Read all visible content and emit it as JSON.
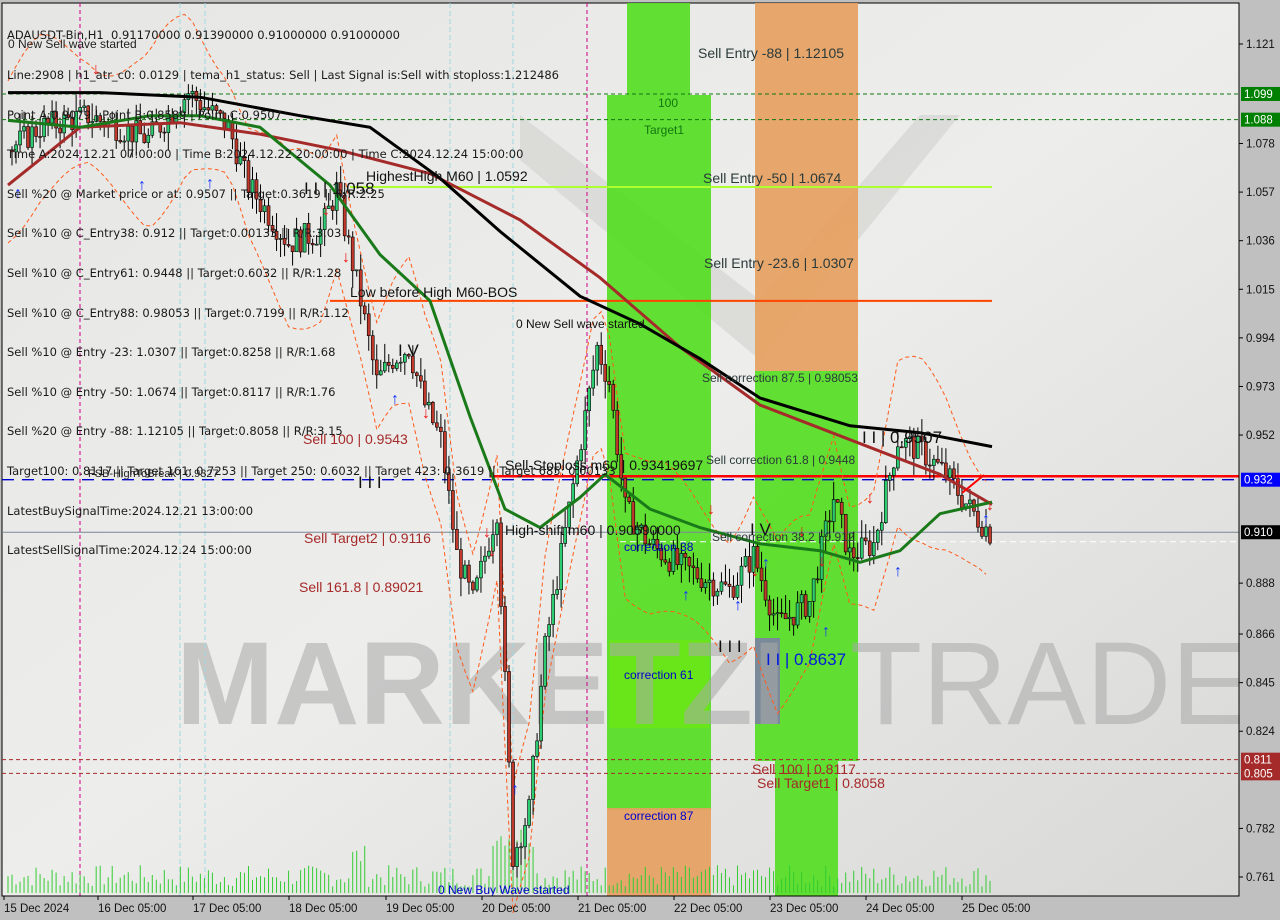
{
  "header": {
    "symbol_line": "ADAUSDT-Bin,H1  0.91170000 0.91390000 0.91000000 0.91000000",
    "info_lines": [
      "Line:2908 | h1_atr_c0: 0.0129 | tema_h1_status: Sell | Last Signal is:Sell with stoploss:1.212486",
      "Point A:0.9079 | Point B:0.8589 | Point C:0.9507",
      "Time A:2024.12.21 07:00:00 | Time B:2024.12.22 20:00:00 | Time C:2024.12.24 15:00:00",
      "Sell %20 @ Market price or at: 0.9507 || Target:0.3619 || R/R:2.25",
      "Sell %10 @ C_Entry38: 0.912 || Target:0.00133 || R/R:3.03",
      "Sell %10 @ C_Entry61: 0.9448 || Target:0.6032 || R/R:1.28",
      "Sell %10 @ C_Entry88: 0.98053 || Target:0.7199 || R/R:1.12",
      "Sell %10 @ Entry -23: 1.0307 || Target:0.8258 || R/R:1.68",
      "Sell %10 @ Entry -50: 1.0674 || Target:0.8117 || R/R:1.76",
      "Sell %20 @ Entry -88: 1.12105 || Target:0.8058 || R/R:3.15",
      "Target100: 0.8117 || Target 161: 0.7253 || Target 250: 0.6032 || Target 423: 0.3619 || Target 685: 0.00133",
      "LatestBuySignalTime:2024.12.21 13:00:00",
      "LatestSellSignalTime:2024.12.24 15:00:00"
    ],
    "overlap_label": "0 New Sell wave started"
  },
  "watermark": {
    "left": "MARKETZI",
    "right": "TRADE"
  },
  "colors": {
    "background": "#c0c0c0",
    "plot_bg": "#e2e2e0",
    "bull": "#2ecc71",
    "bear": "#c0392b",
    "zone_green": "#55dd22",
    "zone_orange": "#e6a060",
    "ma_black": "#000000",
    "ma_brown": "#a52a2a",
    "ma_green": "#1a7a1a",
    "stoploss_red": "#ff0000",
    "fsb_blue": "#0000cc",
    "entry_lime": "#adff2f",
    "bos_orange": "#ff4500"
  },
  "chart_data": {
    "type": "candlestick",
    "title": "ADAUSDT-Bin,H1",
    "ohlc_current": {
      "open": 0.9117,
      "high": 0.9139,
      "low": 0.91,
      "close": 0.91
    },
    "ylim": [
      0.755,
      1.135
    ],
    "y_ticks": [
      "1.121",
      "1.078",
      "1.057",
      "1.036",
      "1.015",
      "0.994",
      "0.973",
      "0.952",
      "0.888",
      "0.866",
      "0.845",
      "0.824",
      "0.782",
      "0.761"
    ],
    "x_ticks": [
      "15 Dec 2024",
      "16 Dec 05:00",
      "17 Dec 05:00",
      "18 Dec 05:00",
      "19 Dec 05:00",
      "20 Dec 05:00",
      "21 Dec 05:00",
      "22 Dec 05:00",
      "23 Dec 05:00",
      "24 Dec 05:00",
      "25 Dec 05:00"
    ],
    "price_tags": [
      {
        "value": "1.099",
        "price": 1.0994,
        "color": "#008000"
      },
      {
        "value": "1.088",
        "price": 1.0883,
        "color": "#008000"
      },
      {
        "value": "0.932",
        "price": 0.9327,
        "color": "#0000ff"
      },
      {
        "value": "0.910",
        "price": 0.91,
        "color": "#000000"
      },
      {
        "value": "0.811",
        "price": 0.8117,
        "color": "#a52a2a"
      },
      {
        "value": "0.805",
        "price": 0.8058,
        "color": "#a52a2a"
      }
    ],
    "levels": [
      {
        "name": "highest-high",
        "label": "HighestHigh   M60 | 1.0592",
        "price": 1.0592
      },
      {
        "name": "low-before-high",
        "label": "Low before High   M60-BOS",
        "price": 1.01
      },
      {
        "name": "fsb-high-to-break",
        "label": "FSB-HighToBreak | 0.9327",
        "price": 0.9327
      },
      {
        "name": "sell-stoploss",
        "label": "Sell-Stoploss m60 | 0.93419697",
        "price": 0.9342
      },
      {
        "name": "high-shift",
        "label": "High-shift m60 | 0.90590000",
        "price": 0.9059
      },
      {
        "name": "current-price",
        "label": "",
        "price": 0.91
      },
      {
        "name": "target-100",
        "label": "",
        "price": 1.0994
      },
      {
        "name": "target-1",
        "label": "",
        "price": 1.0883
      },
      {
        "name": "sell-100-low",
        "label": "Sell 100 | 0.8117",
        "price": 0.8117
      },
      {
        "name": "sell-target1",
        "label": "Sell Target1 | 0.8058",
        "price": 0.8058
      }
    ],
    "annotations": [
      {
        "text": "Sell Entry -88 | 1.12105",
        "price": 1.12105
      },
      {
        "text": "Sell Entry -50 | 1.0674",
        "price": 1.0674
      },
      {
        "text": "Sell Entry -23.6 | 1.0307",
        "price": 1.0307
      },
      {
        "text": "Sell correction 87.5 | 0.98053",
        "price": 0.98053
      },
      {
        "text": "Sell correction 61.8 | 0.9448",
        "price": 0.9448
      },
      {
        "text": "Sell correction 38.2 | 0.912",
        "price": 0.912
      },
      {
        "text": "Sell 100 | 0.9543",
        "price": 0.9543
      },
      {
        "text": "Sell Target2 | 0.9116",
        "price": 0.9116
      },
      {
        "text": "Sell 161.8 | 0.89021",
        "price": 0.89021
      },
      {
        "text": "I I | 1.058",
        "price": 1.058
      },
      {
        "text": "I I | 0.9507",
        "price": 0.9507
      },
      {
        "text": "I I | 0.8637",
        "price": 0.8637
      },
      {
        "text": "I V",
        "price": 0.9915
      },
      {
        "text": "I V",
        "price": 0.913
      },
      {
        "text": "I I I",
        "price": 0.9327
      },
      {
        "text": "I I I",
        "price": 0.872
      },
      {
        "text": "100",
        "price": 1.097
      },
      {
        "text": "Target1",
        "price": 1.087
      },
      {
        "text": "0 New Sell wave started",
        "price": 1.003
      },
      {
        "text": "0 New Buy Wave started",
        "price": 0.758
      },
      {
        "text": "correction 38",
        "price": 0.9035
      },
      {
        "text": "correction 61",
        "price": 0.85
      },
      {
        "text": "correction 87",
        "price": 0.793
      }
    ]
  }
}
